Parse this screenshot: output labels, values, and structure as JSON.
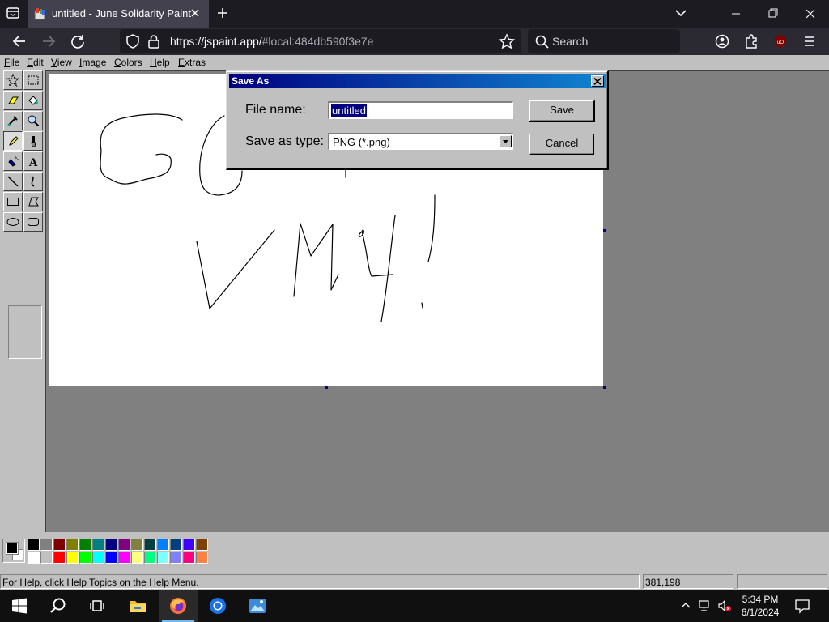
{
  "browser": {
    "tab_title": "untitled - June Solidarity Paint",
    "url_host": "https://jspaint.app/",
    "url_hash": "#local:484db590f3e7e",
    "search_placeholder": "Search"
  },
  "menu": {
    "items": [
      {
        "label": "File",
        "hotkey_index": 0
      },
      {
        "label": "Edit",
        "hotkey_index": 0
      },
      {
        "label": "View",
        "hotkey_index": 0
      },
      {
        "label": "Image",
        "hotkey_index": 0
      },
      {
        "label": "Colors",
        "hotkey_index": 0
      },
      {
        "label": "Help",
        "hotkey_index": 0
      },
      {
        "label": "Extras",
        "hotkey_index": 0
      }
    ]
  },
  "tools": [
    {
      "name": "free-form-select-tool",
      "icon": "star-select-icon"
    },
    {
      "name": "select-tool",
      "icon": "rect-select-icon"
    },
    {
      "name": "eraser-tool",
      "icon": "eraser-icon"
    },
    {
      "name": "fill-tool",
      "icon": "paint-bucket-icon"
    },
    {
      "name": "pick-color-tool",
      "icon": "eyedropper-icon"
    },
    {
      "name": "magnifier-tool",
      "icon": "magnifier-icon"
    },
    {
      "name": "pencil-tool",
      "icon": "pencil-icon",
      "selected": true
    },
    {
      "name": "brush-tool",
      "icon": "brush-icon"
    },
    {
      "name": "airbrush-tool",
      "icon": "airbrush-icon"
    },
    {
      "name": "text-tool",
      "icon": "text-a-icon"
    },
    {
      "name": "line-tool",
      "icon": "line-icon"
    },
    {
      "name": "curve-tool",
      "icon": "curve-icon"
    },
    {
      "name": "rectangle-tool",
      "icon": "rectangle-icon"
    },
    {
      "name": "polygon-tool",
      "icon": "polygon-icon"
    },
    {
      "name": "ellipse-tool",
      "icon": "ellipse-icon"
    },
    {
      "name": "rounded-rectangle-tool",
      "icon": "rounded-rect-icon"
    }
  ],
  "palette": {
    "foreground": "#000000",
    "background": "#ffffff",
    "top_row": [
      "#000000",
      "#808080",
      "#800000",
      "#808000",
      "#008000",
      "#008080",
      "#000080",
      "#800080",
      "#808040",
      "#004040",
      "#0080ff",
      "#004080",
      "#4000ff",
      "#804000"
    ],
    "bottom_row": [
      "#ffffff",
      "#c0c0c0",
      "#ff0000",
      "#ffff00",
      "#00ff00",
      "#00ffff",
      "#0000ff",
      "#ff00ff",
      "#ffff80",
      "#00ff80",
      "#80ffff",
      "#8080ff",
      "#ff0080",
      "#ff8040"
    ]
  },
  "status": {
    "help_text": "For Help, click Help Topics on the Help Menu.",
    "coordinates": "381,198",
    "size": ""
  },
  "dialog": {
    "title": "Save As",
    "file_name_label": "File name:",
    "file_name_value": "untitled",
    "save_as_type_label": "Save as type:",
    "save_as_type_value": "PNG (*.png)",
    "save_label": "Save",
    "cancel_label": "Cancel"
  },
  "taskbar": {
    "time": "5:34 PM",
    "date": "6/1/2024"
  },
  "colors": {
    "dialog_title_start": "#000080",
    "dialog_title_end": "#1084d0",
    "browser_tab": "#42414d",
    "browser_toolbar": "#2b2a33"
  }
}
